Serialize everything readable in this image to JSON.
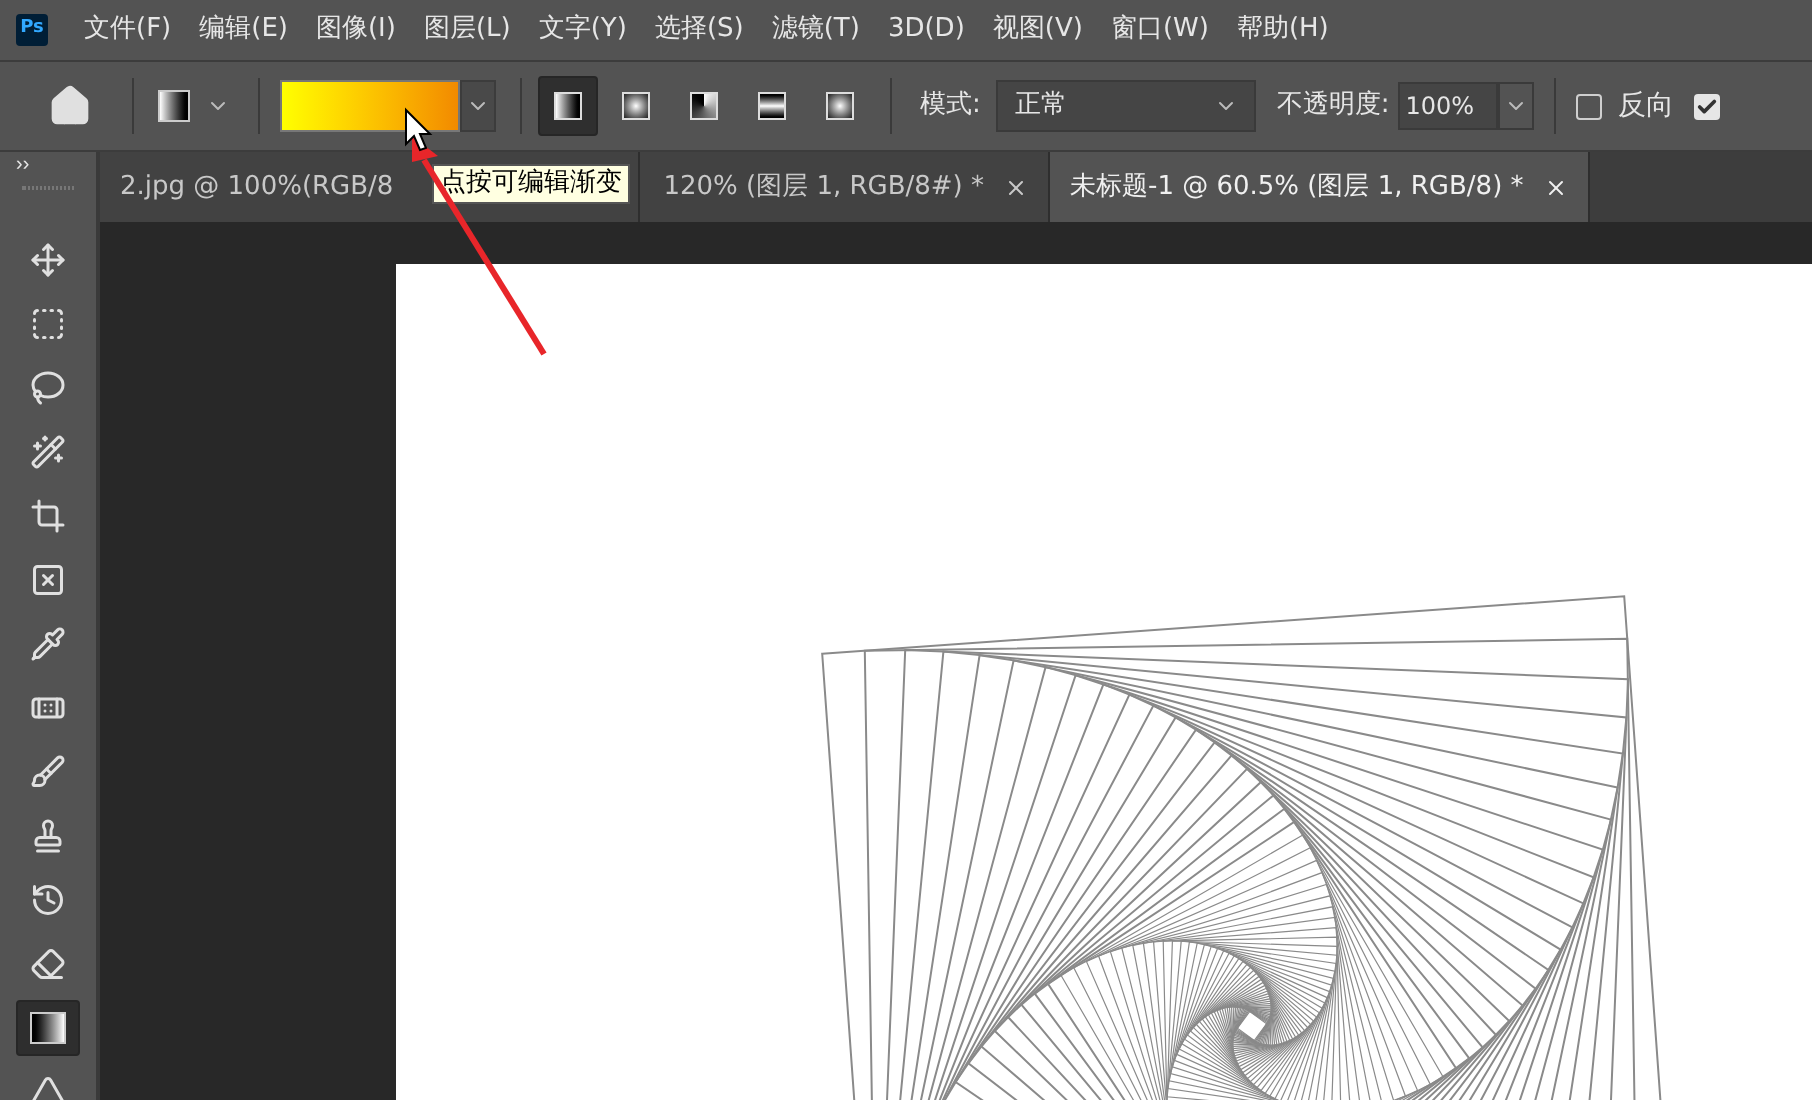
{
  "menu_bar": {
    "logo": "Ps",
    "items": [
      "文件(F)",
      "编辑(E)",
      "图像(I)",
      "图层(L)",
      "文字(Y)",
      "选择(S)",
      "滤镜(T)",
      "3D(D)",
      "视图(V)",
      "窗口(W)",
      "帮助(H)"
    ]
  },
  "options_bar": {
    "gradient_types": [
      {
        "kind": "linear",
        "selected": true
      },
      {
        "kind": "radial",
        "selected": false
      },
      {
        "kind": "angle",
        "selected": false
      },
      {
        "kind": "reflected",
        "selected": false
      },
      {
        "kind": "diamond",
        "selected": false
      }
    ],
    "mode": {
      "label": "模式:",
      "value": "正常"
    },
    "opacity": {
      "label": "不透明度:",
      "value": "100%"
    },
    "checkboxes": [
      {
        "label": "反向",
        "checked": false
      },
      {
        "checked": true
      }
    ]
  },
  "tooltip": "点按可编辑渐变",
  "collapse_toggle": "››",
  "tabs": [
    {
      "title": "2.jpg @ 100%(RGB/8",
      "selected": false,
      "close": false
    },
    {
      "title": "120% (图层 1, RGB/8#) *",
      "selected": false,
      "close": true
    },
    {
      "title": "未标题-1 @ 60.5% (图层 1, RGB/8) *",
      "selected": true,
      "close": true
    }
  ],
  "tools": [
    {
      "kind": "move",
      "selected": false
    },
    {
      "kind": "marquee",
      "selected": false
    },
    {
      "kind": "lasso",
      "selected": false
    },
    {
      "kind": "quick-select",
      "selected": false
    },
    {
      "kind": "crop",
      "selected": false
    },
    {
      "kind": "frame",
      "selected": false
    },
    {
      "kind": "eyedropper",
      "selected": false
    },
    {
      "kind": "healing",
      "selected": false
    },
    {
      "kind": "brush",
      "selected": false
    },
    {
      "kind": "stamp",
      "selected": false
    },
    {
      "kind": "history-brush",
      "selected": false
    },
    {
      "kind": "eraser",
      "selected": false
    },
    {
      "kind": "gradient",
      "selected": true
    },
    {
      "kind": "pen",
      "selected": false
    }
  ]
}
